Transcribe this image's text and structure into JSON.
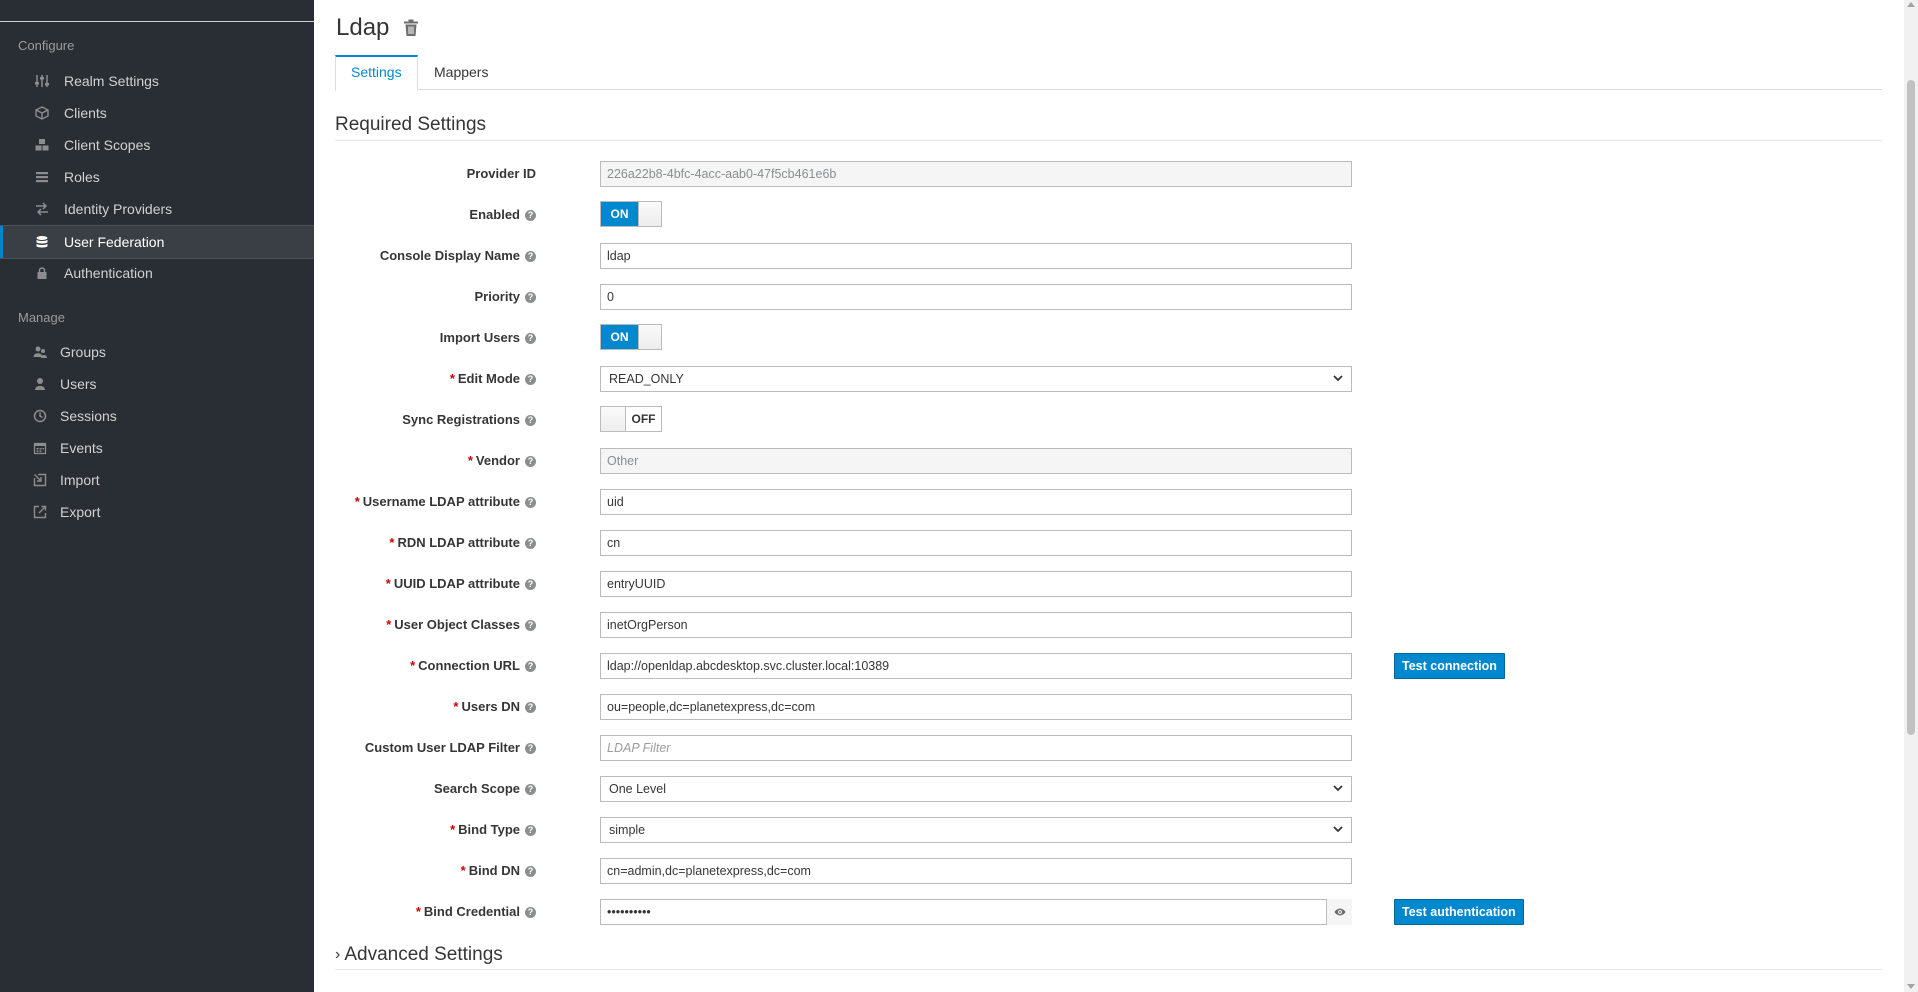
{
  "sidebar": {
    "configure_title": "Configure",
    "manage_title": "Manage",
    "configure_items": [
      {
        "label": "Realm Settings",
        "icon": "sliders-icon"
      },
      {
        "label": "Clients",
        "icon": "cube-icon"
      },
      {
        "label": "Client Scopes",
        "icon": "cubes-icon"
      },
      {
        "label": "Roles",
        "icon": "list-icon"
      },
      {
        "label": "Identity Providers",
        "icon": "exchange-icon"
      },
      {
        "label": "User Federation",
        "icon": "database-icon",
        "active": true
      },
      {
        "label": "Authentication",
        "icon": "lock-icon"
      }
    ],
    "manage_items": [
      {
        "label": "Groups",
        "icon": "users-icon"
      },
      {
        "label": "Users",
        "icon": "user-icon"
      },
      {
        "label": "Sessions",
        "icon": "clock-icon"
      },
      {
        "label": "Events",
        "icon": "calendar-icon"
      },
      {
        "label": "Import",
        "icon": "import-icon"
      },
      {
        "label": "Export",
        "icon": "export-icon"
      }
    ]
  },
  "header": {
    "title": "Ldap"
  },
  "tabs": [
    {
      "label": "Settings",
      "active": true
    },
    {
      "label": "Mappers",
      "active": false
    }
  ],
  "required_settings": {
    "heading": "Required Settings",
    "provider_id": {
      "label": "Provider ID",
      "value": "226a22b8-4bfc-4acc-aab0-47f5cb461e6b"
    },
    "enabled": {
      "label": "Enabled",
      "state": "ON"
    },
    "console_display_name": {
      "label": "Console Display Name",
      "value": "ldap"
    },
    "priority": {
      "label": "Priority",
      "value": "0"
    },
    "import_users": {
      "label": "Import Users",
      "state": "ON"
    },
    "edit_mode": {
      "label": "Edit Mode",
      "value": "READ_ONLY"
    },
    "sync_registrations": {
      "label": "Sync Registrations",
      "state": "OFF"
    },
    "vendor": {
      "label": "Vendor",
      "value": "Other"
    },
    "username_ldap_attribute": {
      "label": "Username LDAP attribute",
      "value": "uid"
    },
    "rdn_ldap_attribute": {
      "label": "RDN LDAP attribute",
      "value": "cn"
    },
    "uuid_ldap_attribute": {
      "label": "UUID LDAP attribute",
      "value": "entryUUID"
    },
    "user_object_classes": {
      "label": "User Object Classes",
      "value": "inetOrgPerson"
    },
    "connection_url": {
      "label": "Connection URL",
      "value": "ldap://openldap.abcdesktop.svc.cluster.local:10389",
      "button": "Test connection"
    },
    "users_dn": {
      "label": "Users DN",
      "value": "ou=people,dc=planetexpress,dc=com"
    },
    "custom_user_ldap_filter": {
      "label": "Custom User LDAP Filter",
      "value": "",
      "placeholder": "LDAP Filter"
    },
    "search_scope": {
      "label": "Search Scope",
      "value": "One Level"
    },
    "bind_type": {
      "label": "Bind Type",
      "value": "simple"
    },
    "bind_dn": {
      "label": "Bind DN",
      "value": "cn=admin,dc=planetexpress,dc=com"
    },
    "bind_credential": {
      "label": "Bind Credential",
      "value": "**********",
      "button": "Test authentication"
    }
  },
  "advanced_settings": {
    "heading": "Advanced Settings"
  },
  "colors": {
    "accent": "#0088ce",
    "sidebar_bg": "#292e34",
    "required": "#cc0000"
  }
}
